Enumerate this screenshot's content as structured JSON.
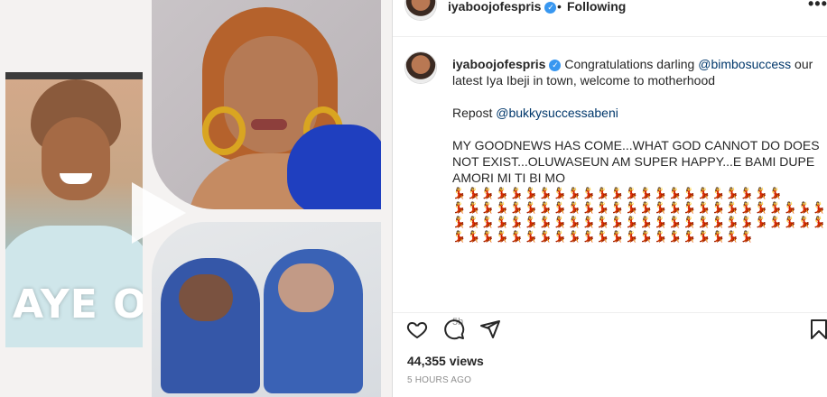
{
  "header": {
    "username": "iyaboojofespris",
    "separator": "•",
    "follow_status": "Following",
    "more_icon": "•••"
  },
  "media": {
    "left_caption": "AYE OPE",
    "play_icon": "play-icon"
  },
  "caption": {
    "username": "iyaboojofespris",
    "text_1": "Congratulations darling ",
    "mention_1": "@bimbosuccess",
    "text_2": " our latest Iya Ibeji in town, welcome to motherhood",
    "repost_label": "Repost ",
    "mention_2": "@bukkysuccessabeni",
    "body": "MY GOODNEWS HAS COME...WHAT GOD CANNOT DO DOES NOT EXIST...OLUWASEUN AM SUPER HAPPY...E BAMI DUPE AMORI MI TI BI MO",
    "emoji_line_1": "💃💃💃💃💃💃💃💃💃💃💃💃💃💃💃💃💃💃💃💃💃💃💃",
    "emoji_line_2": "💃💃💃💃💃💃💃💃💃💃💃💃💃💃💃💃💃💃💃💃💃💃💃💃💃💃",
    "emoji_line_3": "💃💃💃💃💃💃💃💃💃💃💃💃💃💃💃💃💃💃💃💃💃💃💃💃💃💃",
    "emoji_line_4": "💃💃💃💃💃💃💃💃💃💃💃💃💃💃💃💃💃💃💃💃💃",
    "relative_time": "5h"
  },
  "stats": {
    "views": "44,355 views",
    "posted": "5 HOURS AGO"
  },
  "colors": {
    "verified": "#3897f0",
    "mention": "#00376b",
    "muted": "#8e8e8e"
  }
}
